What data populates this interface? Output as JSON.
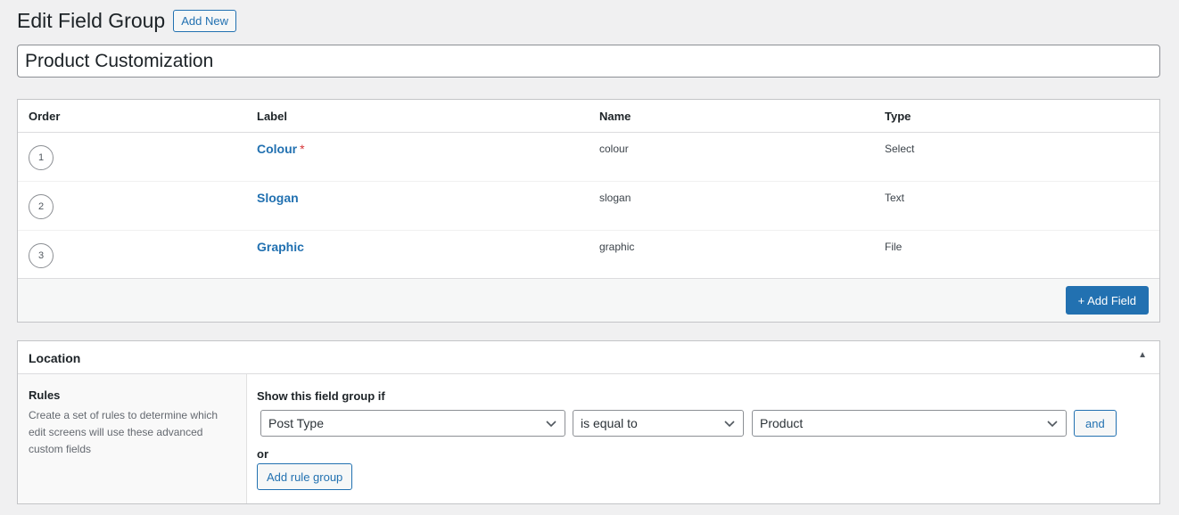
{
  "header": {
    "title": "Edit Field Group",
    "add_new_label": "Add New"
  },
  "title_field": {
    "value": "Product Customization"
  },
  "fields_table": {
    "columns": {
      "order": "Order",
      "label": "Label",
      "name": "Name",
      "type": "Type"
    },
    "rows": [
      {
        "order": "1",
        "label": "Colour",
        "required": "*",
        "name": "colour",
        "type": "Select"
      },
      {
        "order": "2",
        "label": "Slogan",
        "required": "",
        "name": "slogan",
        "type": "Text"
      },
      {
        "order": "3",
        "label": "Graphic",
        "required": "",
        "name": "graphic",
        "type": "File"
      }
    ],
    "add_field_label": "+ Add Field"
  },
  "location": {
    "title": "Location",
    "toggle_icon": "triangle-up-icon",
    "rules_title": "Rules",
    "rules_description": "Create a set of rules to determine which edit screens will use these advanced custom fields",
    "show_if_label": "Show this field group if",
    "rule": {
      "param": "Post Type",
      "operator": "is equal to",
      "value": "Product"
    },
    "and_label": "and",
    "or_label": "or",
    "add_rule_group_label": "Add rule group"
  },
  "colors": {
    "accent": "#2271b1",
    "required": "#d63638",
    "border": "#c3c4c7"
  }
}
